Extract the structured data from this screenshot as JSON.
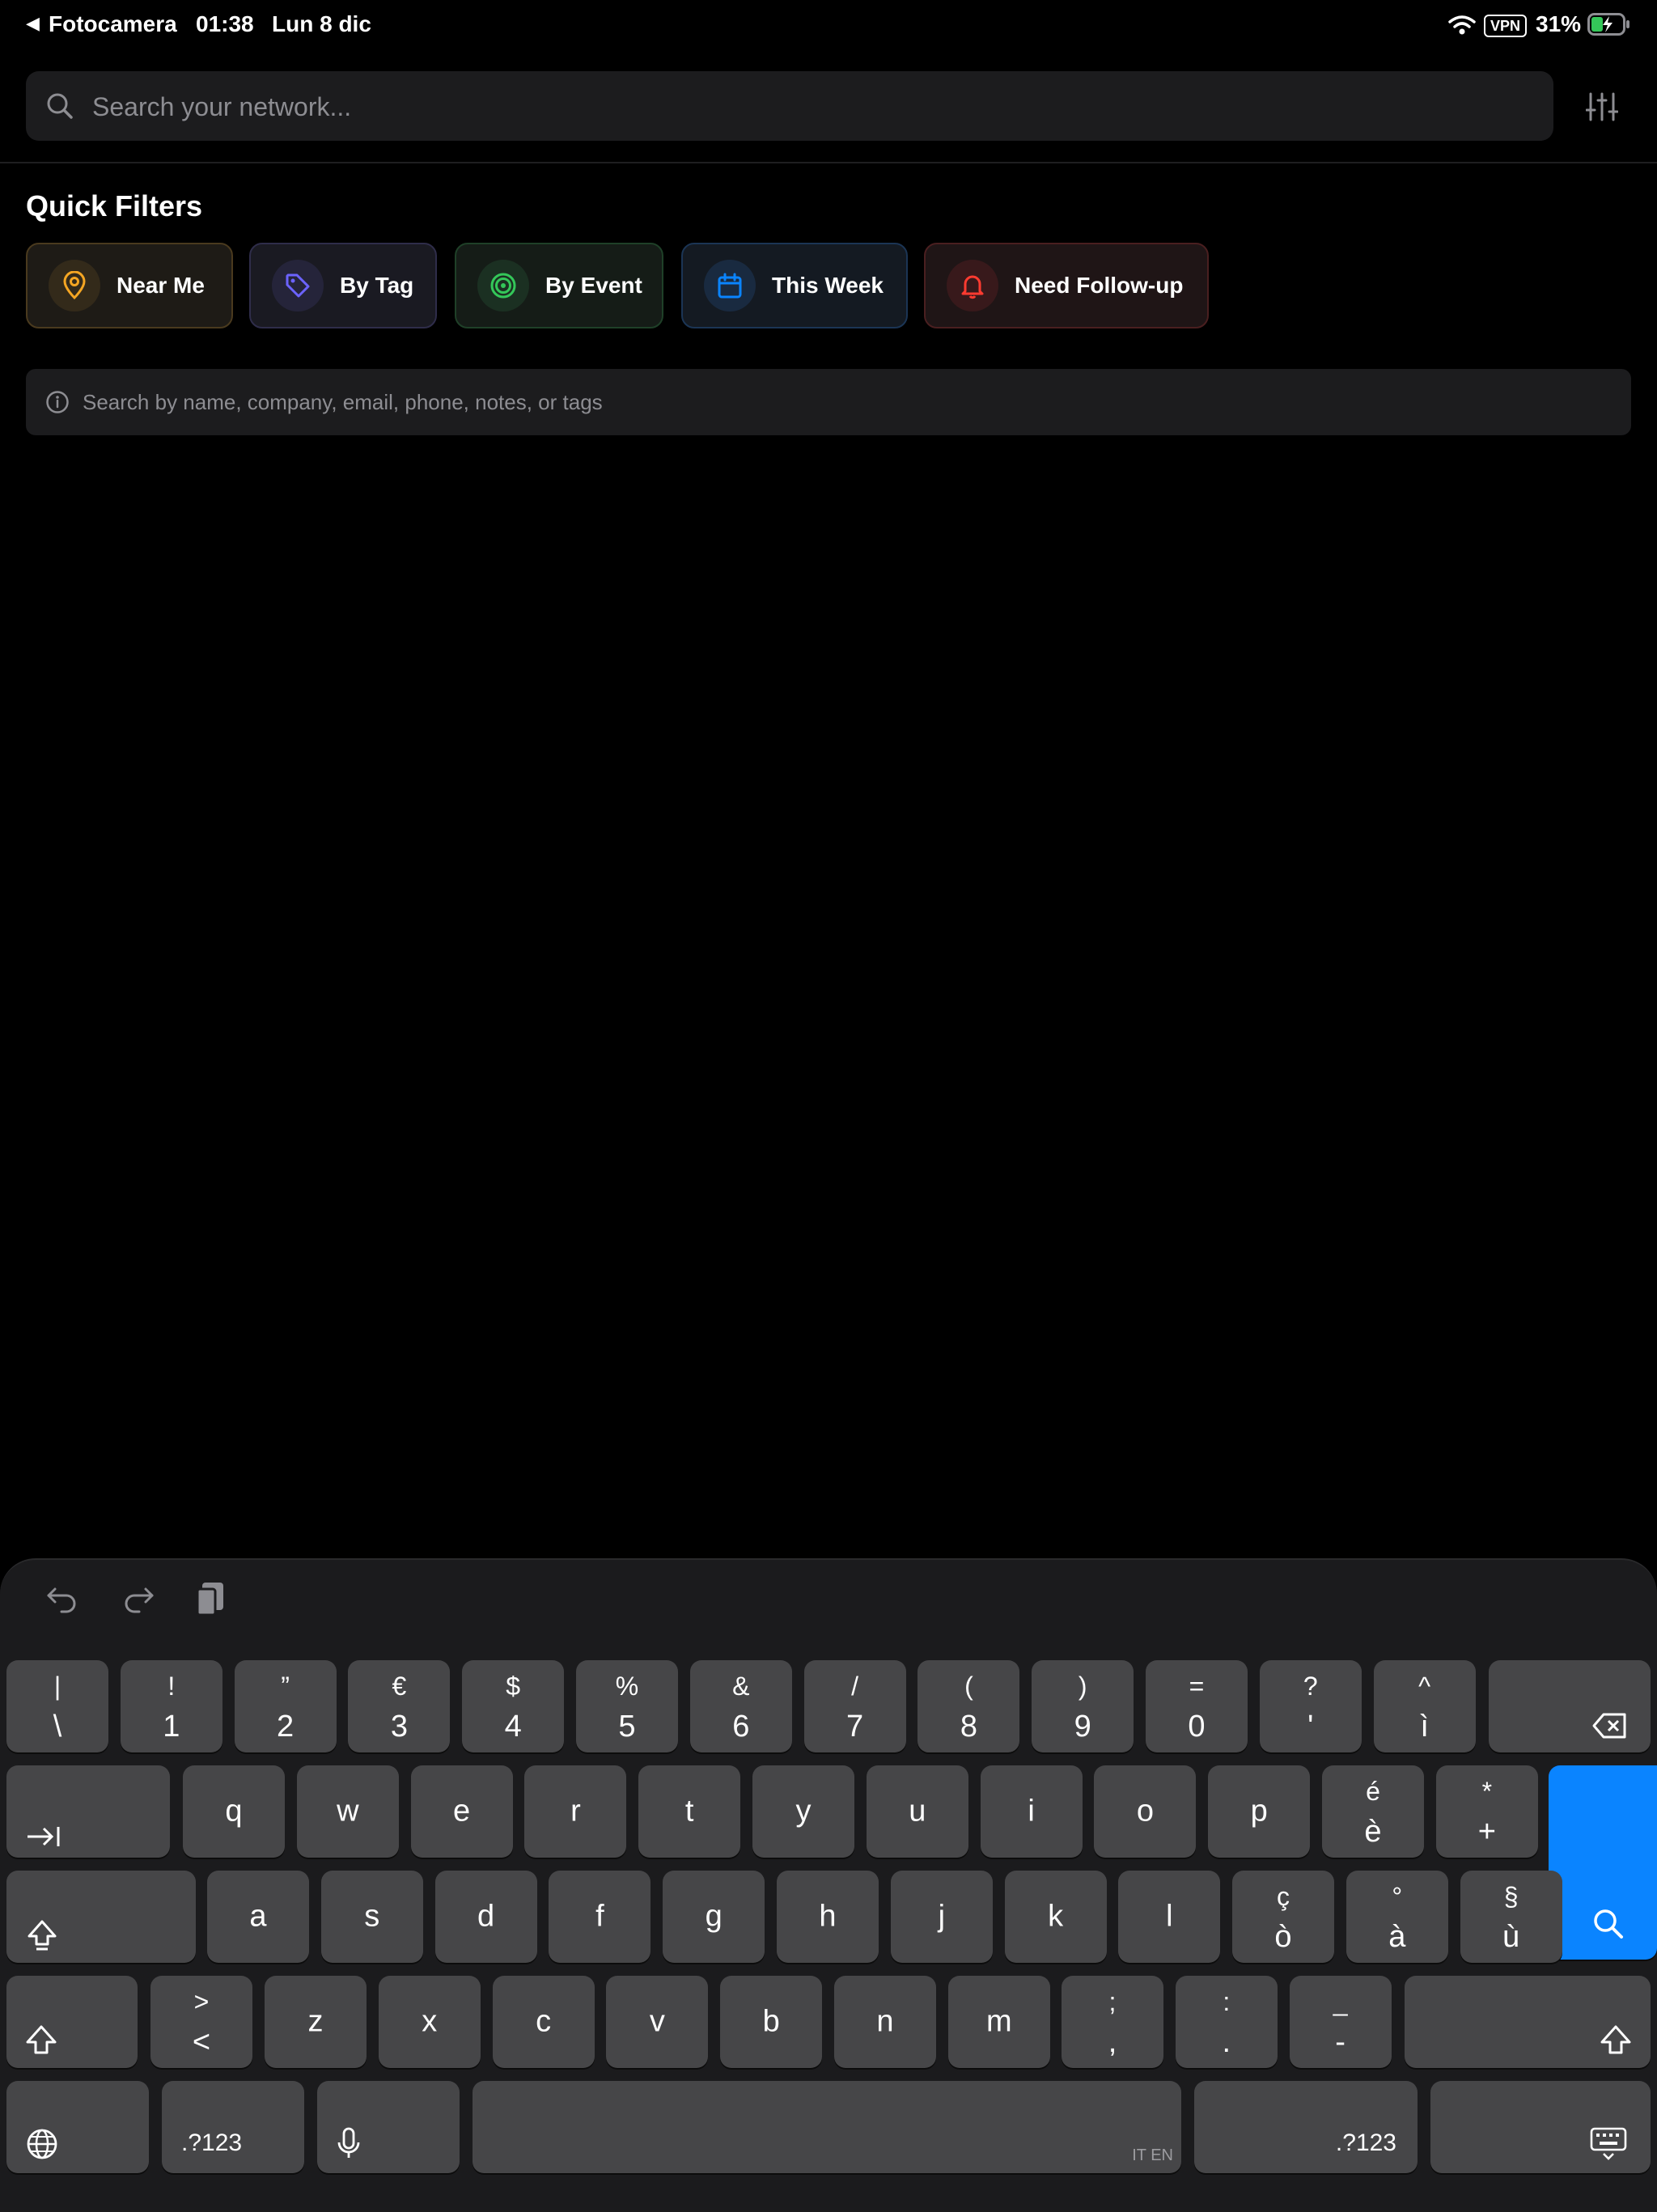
{
  "status_bar": {
    "back_app": "Fotocamera",
    "time": "01:38",
    "date": "Lun 8 dic",
    "vpn": "VPN",
    "battery": "31%"
  },
  "search": {
    "placeholder": "Search your network..."
  },
  "quick_filters": {
    "title": "Quick Filters",
    "chips": [
      {
        "label": "Near Me",
        "icon": "map-pin-icon",
        "color": "#f5a623"
      },
      {
        "label": "By Tag",
        "icon": "tag-icon",
        "color": "#6c63ff"
      },
      {
        "label": "By Event",
        "icon": "target-icon",
        "color": "#34c759"
      },
      {
        "label": "This Week",
        "icon": "calendar-icon",
        "color": "#0a84ff"
      },
      {
        "label": "Need Follow-up",
        "icon": "bell-icon",
        "color": "#ff3b30"
      }
    ]
  },
  "hint": {
    "text": "Search by name, company, email, phone, notes, or tags"
  },
  "keyboard": {
    "toolbar": [
      "undo-icon",
      "redo-icon",
      "paste-icon"
    ],
    "number_row": [
      {
        "top": "|",
        "bottom": "\\"
      },
      {
        "top": "!",
        "bottom": "1"
      },
      {
        "top": "”",
        "bottom": "2"
      },
      {
        "top": "€",
        "bottom": "3"
      },
      {
        "top": "$",
        "bottom": "4"
      },
      {
        "top": "%",
        "bottom": "5"
      },
      {
        "top": "&",
        "bottom": "6"
      },
      {
        "top": "/",
        "bottom": "7"
      },
      {
        "top": "(",
        "bottom": "8"
      },
      {
        "top": ")",
        "bottom": "9"
      },
      {
        "top": "=",
        "bottom": "0"
      },
      {
        "top": "?",
        "bottom": "'"
      },
      {
        "top": "^",
        "bottom": "ì"
      }
    ],
    "row_q": [
      "q",
      "w",
      "e",
      "r",
      "t",
      "y",
      "u",
      "i",
      "o",
      "p"
    ],
    "row_q_extra": [
      {
        "top": "é",
        "bottom": "è"
      },
      {
        "top": "*",
        "bottom": "+"
      }
    ],
    "row_a": [
      "a",
      "s",
      "d",
      "f",
      "g",
      "h",
      "j",
      "k",
      "l"
    ],
    "row_a_extra": [
      {
        "top": "ç",
        "bottom": "ò"
      },
      {
        "top": "°",
        "bottom": "à"
      },
      {
        "top": "§",
        "bottom": "ù"
      }
    ],
    "row_z_first": {
      "top": ">",
      "bottom": "<"
    },
    "row_z": [
      "z",
      "x",
      "c",
      "v",
      "b",
      "n",
      "m"
    ],
    "row_z_extra": [
      {
        "top": ";",
        "bottom": ","
      },
      {
        "top": ":",
        "bottom": "."
      },
      {
        "top": "_",
        "bottom": "-"
      }
    ],
    "numbers_label": ".?123",
    "space_language": "IT EN",
    "accent": "#0a84ff"
  }
}
